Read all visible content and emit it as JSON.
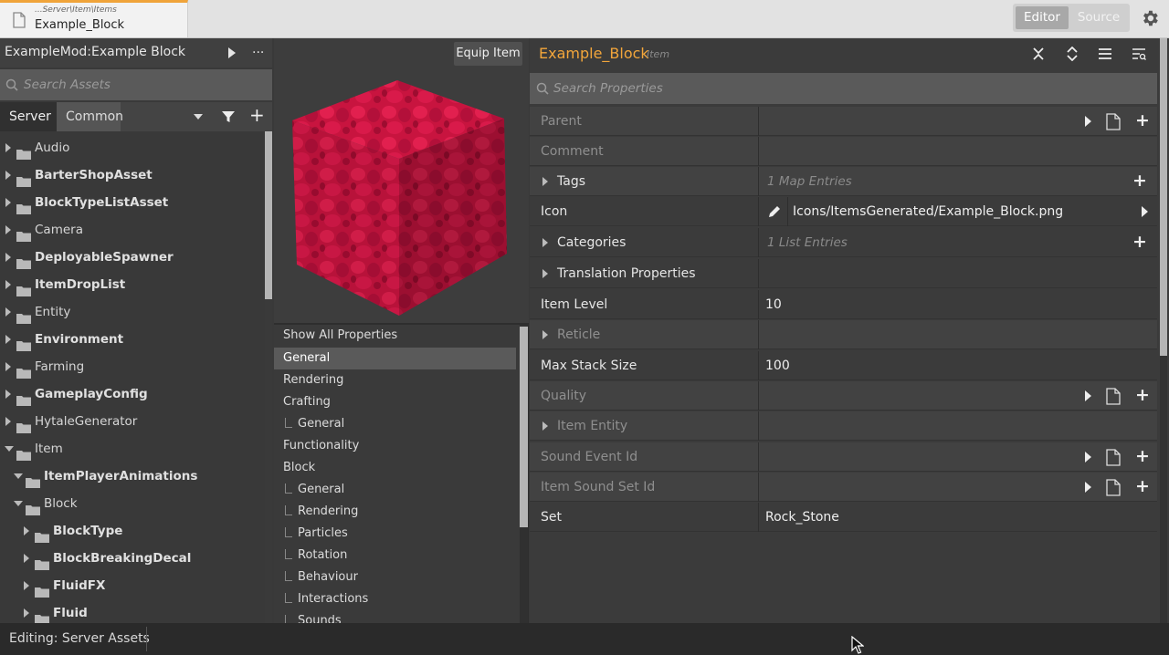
{
  "topbar": {
    "doc_path": "...Server\\Item\\Items",
    "doc_name": "Example_Block",
    "mode_editor": "Editor",
    "mode_source": "Source",
    "accent": "#f0a43a"
  },
  "left": {
    "mod_title": "ExampleMod:Example Block",
    "more_label": "...",
    "search_placeholder": "Search Assets",
    "tabs": [
      "Server",
      "Common"
    ],
    "add_label": "+",
    "tree": [
      {
        "label": "Audio"
      },
      {
        "label": "BarterShopAsset"
      },
      {
        "label": "BlockTypeListAsset"
      },
      {
        "label": "Camera"
      },
      {
        "label": "DeployableSpawner"
      },
      {
        "label": "ItemDropList"
      },
      {
        "label": "Entity"
      },
      {
        "label": "Environment"
      },
      {
        "label": "Farming"
      },
      {
        "label": "GameplayConfig"
      },
      {
        "label": "HytaleGenerator"
      },
      {
        "label": "Item"
      },
      {
        "label": "ItemPlayerAnimations"
      },
      {
        "label": "Block"
      },
      {
        "label": "BlockType"
      },
      {
        "label": "BlockBreakingDecal"
      },
      {
        "label": "FluidFX"
      },
      {
        "label": "Fluid"
      }
    ]
  },
  "middle": {
    "equip_label": "Equip Item",
    "categories": [
      {
        "label": "Show All Properties"
      },
      {
        "label": "General"
      },
      {
        "label": "Rendering"
      },
      {
        "label": "Crafting"
      },
      {
        "label": "General"
      },
      {
        "label": "Functionality"
      },
      {
        "label": "Block"
      },
      {
        "label": "General"
      },
      {
        "label": "Rendering"
      },
      {
        "label": "Particles"
      },
      {
        "label": "Rotation"
      },
      {
        "label": "Behaviour"
      },
      {
        "label": "Interactions"
      },
      {
        "label": "Sounds"
      }
    ]
  },
  "right": {
    "title": "Example_Block",
    "subtitle": "Item",
    "search_placeholder": "Search Properties",
    "rows": [
      {
        "name": "Parent",
        "value": ""
      },
      {
        "name": "Comment",
        "value": ""
      },
      {
        "name": "Tags",
        "value": "1 Map Entries"
      },
      {
        "name": "Icon",
        "value": "Icons/ItemsGenerated/Example_Block.png"
      },
      {
        "name": "Categories",
        "value": "1 List Entries"
      },
      {
        "name": "Translation Properties",
        "value": ""
      },
      {
        "name": "Item Level",
        "value": "10"
      },
      {
        "name": "Reticle",
        "value": ""
      },
      {
        "name": "Max Stack Size",
        "value": "100"
      },
      {
        "name": "Quality",
        "value": ""
      },
      {
        "name": "Item Entity",
        "value": ""
      },
      {
        "name": "Sound Event Id",
        "value": ""
      },
      {
        "name": "Item Sound Set Id",
        "value": ""
      },
      {
        "name": "Set",
        "value": "Rock_Stone"
      }
    ]
  },
  "status": {
    "text": "Editing: Server Assets"
  }
}
